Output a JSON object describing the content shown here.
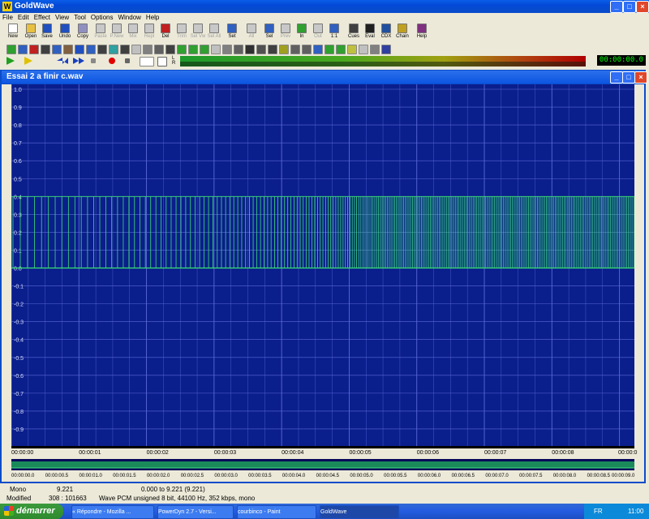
{
  "app": {
    "title": "GoldWave",
    "logo": "W"
  },
  "menu": [
    "File",
    "Edit",
    "Effect",
    "View",
    "Tool",
    "Options",
    "Window",
    "Help"
  ],
  "toolbar1": [
    {
      "label": "New",
      "icon": "new-file-icon",
      "enabled": true
    },
    {
      "label": "Open",
      "icon": "open-folder-icon",
      "enabled": true
    },
    {
      "label": "Save",
      "icon": "save-disk-icon",
      "enabled": true
    },
    {
      "label": "Undo",
      "icon": "undo-icon",
      "enabled": true
    },
    {
      "label": "Copy",
      "icon": "copy-icon",
      "enabled": true
    },
    {
      "label": "Paste",
      "icon": "paste-icon",
      "enabled": false
    },
    {
      "label": "P.New",
      "icon": "paste-new-icon",
      "enabled": false
    },
    {
      "label": "Mix",
      "icon": "mix-icon",
      "enabled": false
    },
    {
      "label": "Repl",
      "icon": "replace-icon",
      "enabled": false
    },
    {
      "label": "Del",
      "icon": "delete-icon",
      "enabled": true
    },
    {
      "label": "Trim",
      "icon": "trim-icon",
      "enabled": false
    },
    {
      "label": "Sel Vw",
      "icon": "select-view-icon",
      "enabled": false
    },
    {
      "label": "Sel All",
      "icon": "select-all-icon",
      "enabled": false
    },
    {
      "label": "Set",
      "icon": "set-icon",
      "enabled": true
    },
    {
      "label": "All",
      "icon": "zoom-all-icon",
      "enabled": false
    },
    {
      "label": "Sel",
      "icon": "zoom-selection-icon",
      "enabled": true
    },
    {
      "label": "Prev",
      "icon": "zoom-previous-icon",
      "enabled": false
    },
    {
      "label": "In",
      "icon": "zoom-in-icon",
      "enabled": true
    },
    {
      "label": "Out",
      "icon": "zoom-out-icon",
      "enabled": false
    },
    {
      "label": "1:1",
      "icon": "zoom-1-1-icon",
      "enabled": true
    },
    {
      "label": "Cues",
      "icon": "cues-icon",
      "enabled": true
    },
    {
      "label": "Eval",
      "icon": "eval-icon",
      "enabled": true
    },
    {
      "label": "CDX",
      "icon": "cdx-icon",
      "enabled": true
    },
    {
      "label": "Chain",
      "icon": "chain-icon",
      "enabled": true
    },
    {
      "label": "Help",
      "icon": "help-book-icon",
      "enabled": true
    }
  ],
  "document": {
    "title": "Essai 2 a finir c.wav",
    "y_labels": [
      "1.0",
      "0.9",
      "0.8",
      "0.7",
      "0.6",
      "0.5",
      "0.4",
      "0.3",
      "0.2",
      "0.1",
      "0.0",
      "-0.1",
      "-0.2",
      "-0.3",
      "-0.4",
      "-0.5",
      "-0.6",
      "-0.7",
      "-0.8",
      "-0.9"
    ],
    "time_labels": [
      "00:00:00",
      "00:00:01",
      "00:00:02",
      "00:00:03",
      "00:00:04",
      "00:00:05",
      "00:00:06",
      "00:00:07",
      "00:00:08",
      "00:00:0"
    ],
    "overview_labels": [
      "00:00:00.0",
      "00:00:00.5",
      "00:00:01.0",
      "00:00:01.5",
      "00:00:02.0",
      "00:00:02.5",
      "00:00:03.0",
      "00:00:03.5",
      "00:00:04.0",
      "00:00:04.5",
      "00:00:05.0",
      "00:00:05.5",
      "00:00:06.0",
      "00:00:06.5",
      "00:00:07.0",
      "00:00:07.5",
      "00:00:08.0",
      "00:00:08.5",
      "00:00:09.0"
    ],
    "waveform": {
      "min": 0.0,
      "max": 0.4
    }
  },
  "time_display": "00:00:00.0",
  "status": {
    "channel": "Mono",
    "length": "9.221",
    "range": "0.000 to 9.221 (9.221)",
    "state": "Modified",
    "position": "308 : 101663",
    "format": "Wave PCM unsigned 8 bit, 44100 Hz, 352 kbps, mono"
  },
  "taskbar": {
    "start": "démarrer",
    "tasks": [
      "« Répondre - Mozilla ...",
      "PowerDyn 2.7 - Versi...",
      "courbinco - Paint",
      "GoldWave"
    ],
    "lang": "FR",
    "clock": "11:00"
  },
  "colors": {
    "wave_bg": "#0a1e8c",
    "grid": "#5a6ad6",
    "wave": "#3ae070"
  }
}
